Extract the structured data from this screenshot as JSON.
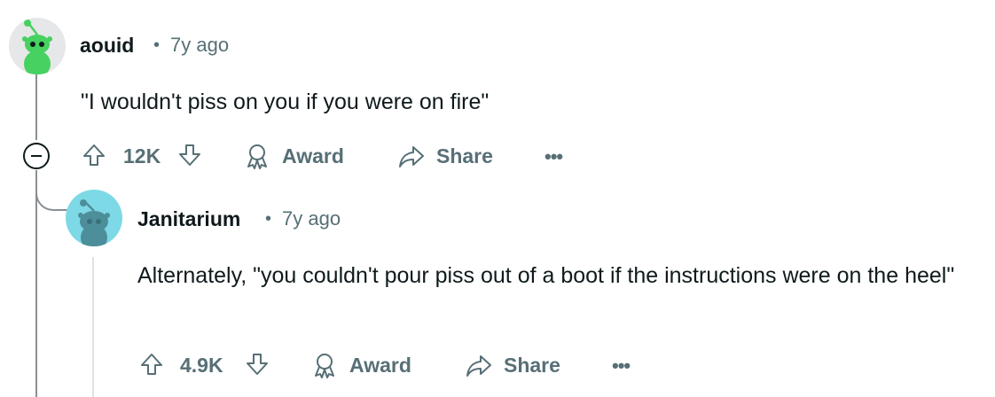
{
  "comments": [
    {
      "username": "aouid",
      "separator": "•",
      "time": "7y ago",
      "body": "\"I wouldn't piss on you if you were on fire\"",
      "votes": "12K",
      "award_label": "Award",
      "share_label": "Share",
      "more_label": "•••",
      "avatar_color": "#e6e7e8",
      "snoo_color": "#46d160"
    },
    {
      "username": "Janitarium",
      "separator": "•",
      "time": "7y ago",
      "body": "Alternately, \"you couldn't pour piss out of a boot if the instructions were on the heel\"",
      "votes": "4.9K",
      "award_label": "Award",
      "share_label": "Share",
      "more_label": "•••",
      "avatar_color": "#7ed9e6",
      "snoo_color": "#4c8e99"
    }
  ]
}
